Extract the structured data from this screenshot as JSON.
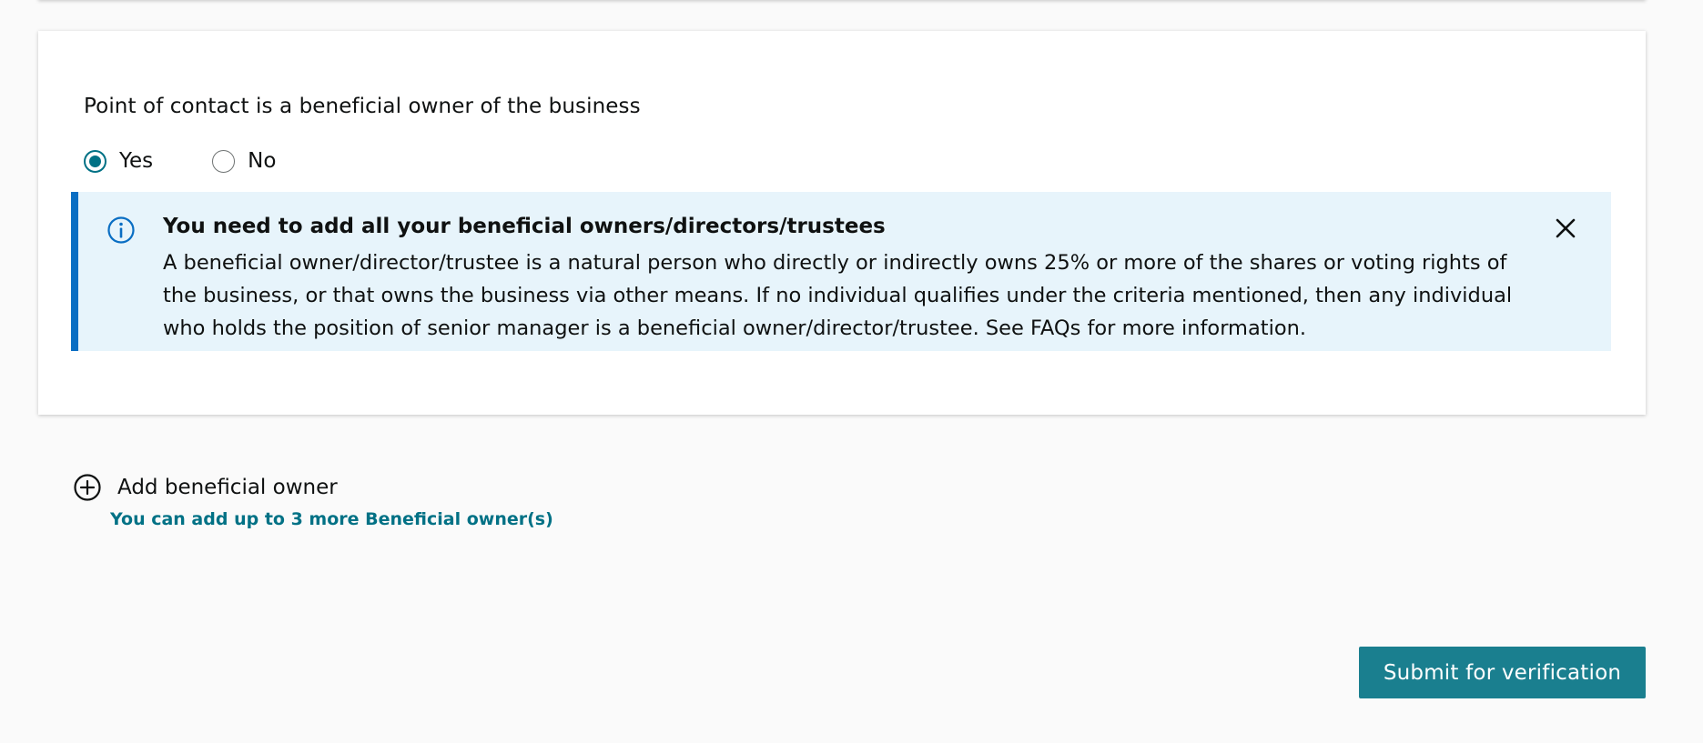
{
  "beneficial_owner_section": {
    "question": "Point of contact is a beneficial owner of the business",
    "options": [
      {
        "label": "Yes",
        "selected": true
      },
      {
        "label": "No",
        "selected": false
      }
    ],
    "alert": {
      "icon": "info-icon",
      "title": "You need to add all your beneficial owners/directors/trustees",
      "body": "A beneficial owner/director/trustee is a natural person who directly or indirectly owns 25% or more of the shares or voting rights of the business, or that owns the business via other means. If no individual qualifies under the criteria mentioned, then any individual who holds the position of senior manager is a beneficial owner/director/trustee. See FAQs for more information.",
      "close_icon": "close-icon",
      "accent_color": "#0a6ec3",
      "background_color": "#e7f4fb"
    }
  },
  "add_owner": {
    "icon": "plus-circle-icon",
    "label": "Add beneficial owner",
    "hint": "You can add up to 3 more Beneficial owner(s)"
  },
  "footer": {
    "submit_label": "Submit for verification",
    "submit_color": "#1a7f8f"
  }
}
